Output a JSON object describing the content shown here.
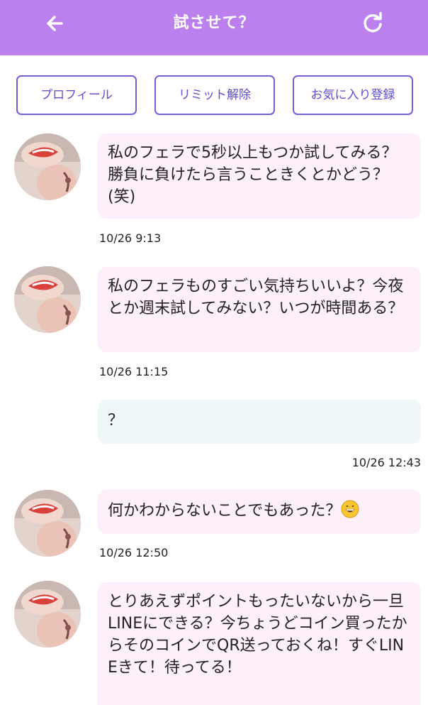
{
  "header": {
    "title": "試させて？",
    "back_icon": "arrow-left-icon",
    "refresh_icon": "refresh-icon",
    "bg_color": "#bb80ee"
  },
  "tabs": [
    {
      "label": "プロフィール"
    },
    {
      "label": "リミット解除"
    },
    {
      "label": "お気に入り登録"
    }
  ],
  "messages": [
    {
      "sender": "other",
      "text": "私のフェラで5秒以上もつか試してみる？勝負に負けたら言うこときくとかどう？(笑)",
      "time": "10/26 9:13"
    },
    {
      "sender": "other",
      "text": "私のフェラものすごい気持ちいいよ？今夜とか週末試してみない？いつが時間ある？",
      "time": "10/26 11:15"
    },
    {
      "sender": "me",
      "text": "？",
      "time": "10/26 12:43"
    },
    {
      "sender": "other",
      "text": "何かわからないことでもあった？",
      "emoji": "grinning-face-emoji",
      "time": "10/26 12:50"
    },
    {
      "sender": "other",
      "text": "とりあえずポイントもったいないから一旦LINEにできる？今ちょうどコイン買ったからそのコインでQR送っておくね！すぐLINEきて！待ってる！",
      "time": ""
    }
  ],
  "colors": {
    "tab_border": "#6f62d6",
    "incoming_bubble": "#fdf0fb",
    "outgoing_bubble": "#eef8f8"
  }
}
